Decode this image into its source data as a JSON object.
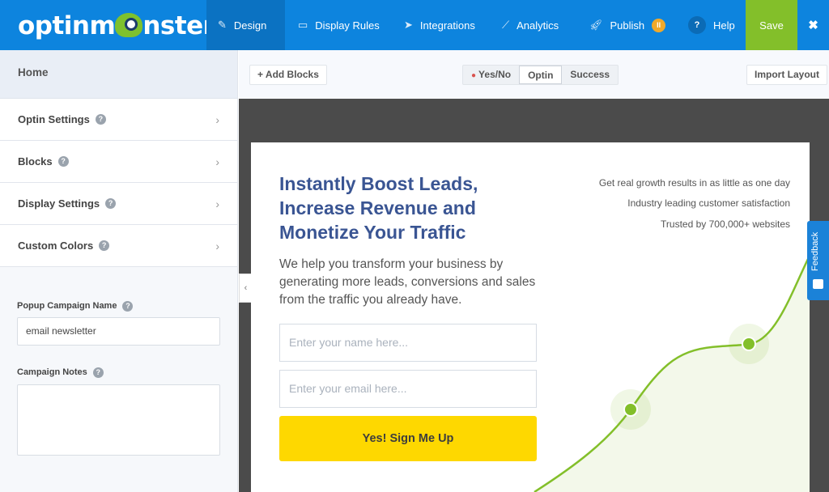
{
  "header": {
    "logo": "optinmonster",
    "nav": [
      {
        "label": "Design",
        "icon": "pencil-icon"
      },
      {
        "label": "Display Rules",
        "icon": "monitor-icon"
      },
      {
        "label": "Integrations",
        "icon": "paper-plane-icon"
      },
      {
        "label": "Analytics",
        "icon": "chart-line-icon"
      },
      {
        "label": "Publish",
        "icon": "rocket-icon"
      },
      {
        "label": "Help",
        "icon": "question-icon"
      }
    ],
    "save": "Save",
    "close": "✖",
    "colors": {
      "header": "#0d84de",
      "save": "#83bf2a",
      "publish_badge": "#f0a92a"
    }
  },
  "sidebar": {
    "home": "Home",
    "items": [
      {
        "label": "Optin Settings"
      },
      {
        "label": "Blocks"
      },
      {
        "label": "Display Settings"
      },
      {
        "label": "Custom Colors"
      }
    ],
    "campaign_name_label": "Popup Campaign Name",
    "campaign_name_value": "email newsletter",
    "notes_label": "Campaign Notes",
    "notes_value": ""
  },
  "toolbar": {
    "add_blocks": "+ Add Blocks",
    "views": [
      "Yes/No",
      "Optin",
      "Success"
    ],
    "active_view": "Optin",
    "import": "Import Layout"
  },
  "popup": {
    "headline": "Instantly Boost Leads, Increase Revenue and Monetize Your Traffic",
    "subtext": "We help you transform your business by generating more leads, conversions and sales from the traffic you already have.",
    "name_placeholder": "Enter your name here...",
    "email_placeholder": "Enter your email here...",
    "cta": "Yes! Sign Me Up",
    "features": [
      "Get real growth results in as little as one day",
      "Industry leading customer satisfaction",
      "Trusted by 700,000+ websites"
    ],
    "cta_color": "#fed800",
    "headline_color": "#3a5593"
  },
  "feedback": "Feedback"
}
